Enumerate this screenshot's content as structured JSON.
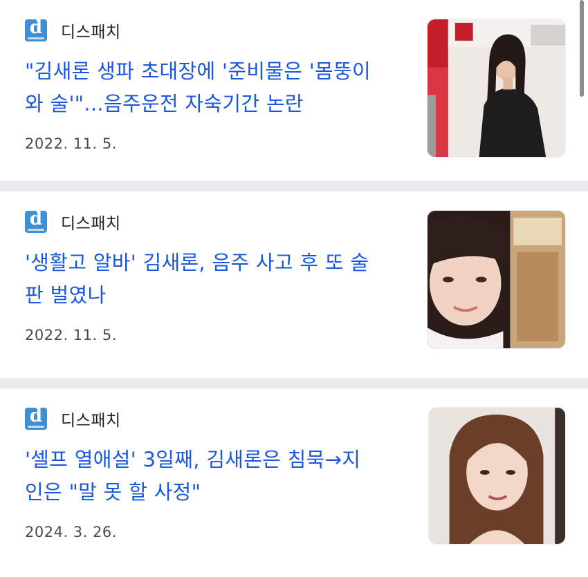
{
  "articles": [
    {
      "source": "디스패치",
      "headline_line1": "\"김새론 생파 초대장에 '준비물은 '몸뚱이",
      "headline_line2": "와 술'\"...음주운전 자숙기간 논란",
      "date": "2022. 11. 5.",
      "thumbnail": "woman-in-black-at-event-photo"
    },
    {
      "source": "디스패치",
      "headline_line1": "'생활고 알바' 김새론, 음주 사고 후 또 술",
      "headline_line2": "판 벌였나",
      "date": "2022. 11. 5.",
      "thumbnail": "young-woman-with-bangs-portrait"
    },
    {
      "source": "디스패치",
      "headline_line1": "'셀프 열애설' 3일째, 김새론은 침묵→지",
      "headline_line2": "인은 \"말 못 할 사정\"",
      "date": "2024. 3. 26.",
      "thumbnail": "woman-long-hair-portrait"
    }
  ],
  "colors": {
    "headline": "#1a57e0",
    "logo": "#3d8fd6",
    "separator": "#e9e9ee"
  }
}
